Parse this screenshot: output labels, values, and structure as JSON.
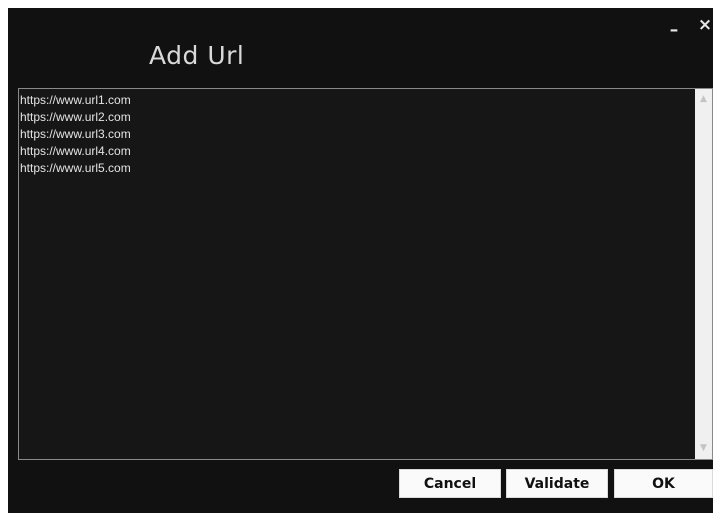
{
  "dialog": {
    "title": "Add Url",
    "minimize_label": "–",
    "close_label": "×"
  },
  "url_list": {
    "text": "https://www.url1.com\nhttps://www.url2.com\nhttps://www.url3.com\nhttps://www.url4.com\nhttps://www.url5.com",
    "scroll_up_icon": "chevron-up-icon",
    "scroll_down_icon": "chevron-down-icon"
  },
  "buttons": {
    "cancel": "Cancel",
    "validate": "Validate",
    "ok": "OK"
  },
  "colors": {
    "window_background": "#111111",
    "text": "#e4e4e4",
    "button_background": "#fafafa"
  }
}
